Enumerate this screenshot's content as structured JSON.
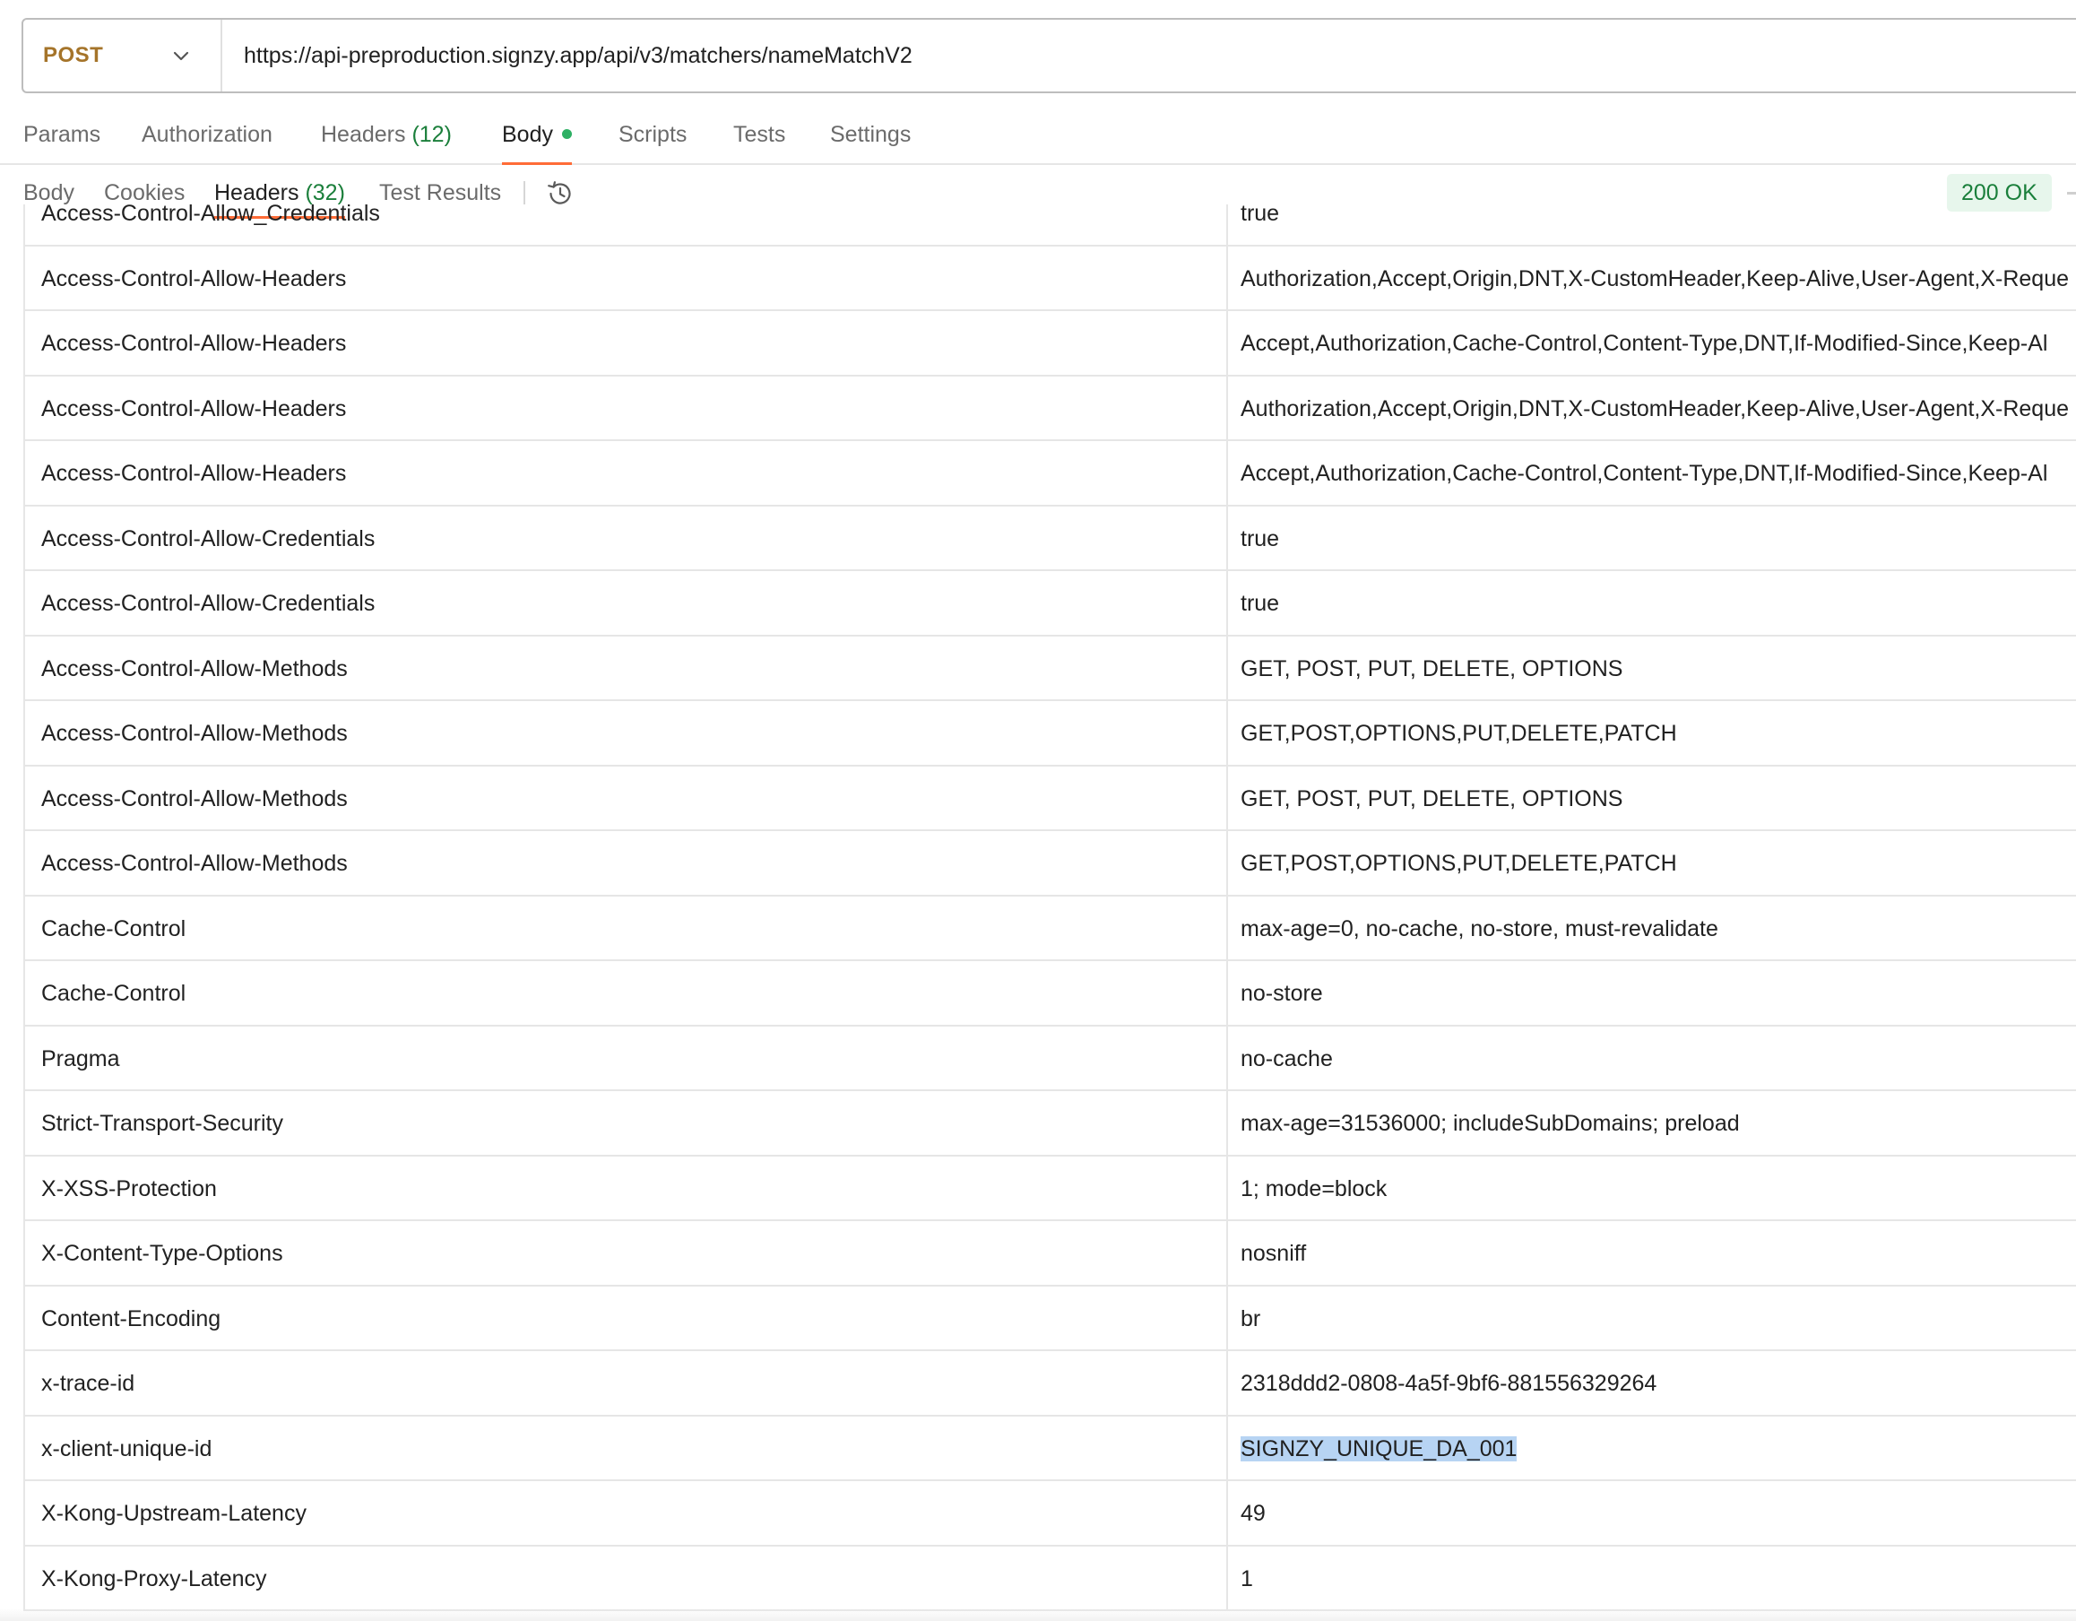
{
  "request": {
    "method": "POST",
    "url": "https://api-preproduction.signzy.app/api/v3/matchers/nameMatchV2"
  },
  "request_tabs": [
    {
      "label": "Params"
    },
    {
      "label": "Authorization"
    },
    {
      "label": "Headers",
      "count": "(12)"
    },
    {
      "label": "Body"
    },
    {
      "label": "Scripts"
    },
    {
      "label": "Tests"
    },
    {
      "label": "Settings"
    }
  ],
  "response_tabs": [
    {
      "label": "Body"
    },
    {
      "label": "Cookies"
    },
    {
      "label": "Headers",
      "count": "(32)"
    },
    {
      "label": "Test Results"
    }
  ],
  "response_status": "200 OK",
  "headers": [
    {
      "key": "Access-Control-Allow_Credentials",
      "value": "true"
    },
    {
      "key": "Access-Control-Allow-Headers",
      "value": "Authorization,Accept,Origin,DNT,X-CustomHeader,Keep-Alive,User-Agent,X-Reque"
    },
    {
      "key": "Access-Control-Allow-Headers",
      "value": "Accept,Authorization,Cache-Control,Content-Type,DNT,If-Modified-Since,Keep-Al"
    },
    {
      "key": "Access-Control-Allow-Headers",
      "value": "Authorization,Accept,Origin,DNT,X-CustomHeader,Keep-Alive,User-Agent,X-Reque"
    },
    {
      "key": "Access-Control-Allow-Headers",
      "value": "Accept,Authorization,Cache-Control,Content-Type,DNT,If-Modified-Since,Keep-Al"
    },
    {
      "key": "Access-Control-Allow-Credentials",
      "value": "true"
    },
    {
      "key": "Access-Control-Allow-Credentials",
      "value": "true"
    },
    {
      "key": "Access-Control-Allow-Methods",
      "value": "GET, POST, PUT, DELETE, OPTIONS"
    },
    {
      "key": "Access-Control-Allow-Methods",
      "value": "GET,POST,OPTIONS,PUT,DELETE,PATCH"
    },
    {
      "key": "Access-Control-Allow-Methods",
      "value": "GET, POST, PUT, DELETE, OPTIONS"
    },
    {
      "key": "Access-Control-Allow-Methods",
      "value": "GET,POST,OPTIONS,PUT,DELETE,PATCH"
    },
    {
      "key": "Cache-Control",
      "value": "max-age=0, no-cache, no-store, must-revalidate"
    },
    {
      "key": "Cache-Control",
      "value": "no-store"
    },
    {
      "key": "Pragma",
      "value": "no-cache"
    },
    {
      "key": "Strict-Transport-Security",
      "value": "max-age=31536000; includeSubDomains; preload"
    },
    {
      "key": "X-XSS-Protection",
      "value": "1; mode=block"
    },
    {
      "key": "X-Content-Type-Options",
      "value": "nosniff"
    },
    {
      "key": "Content-Encoding",
      "value": "br"
    },
    {
      "key": "x-trace-id",
      "value": "2318ddd2-0808-4a5f-9bf6-881556329264"
    },
    {
      "key": "x-client-unique-id",
      "value": "SIGNZY_UNIQUE_DA_001",
      "selected": true
    },
    {
      "key": "X-Kong-Upstream-Latency",
      "value": "49"
    },
    {
      "key": "X-Kong-Proxy-Latency",
      "value": "1"
    }
  ],
  "colors": {
    "method": "#a5742a",
    "active_tab_underline": "#ff6c37",
    "count": "#1b7f3b",
    "status_bg": "#e7f6ec",
    "status_text": "#1a7f3b",
    "selection": "#b7d4f3"
  }
}
